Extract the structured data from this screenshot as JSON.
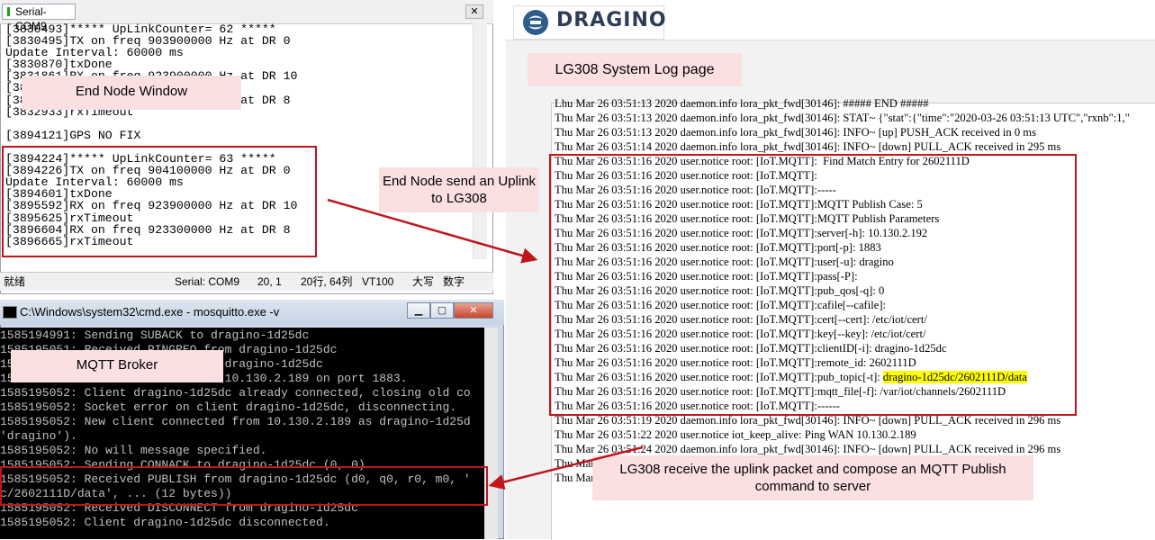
{
  "serial": {
    "tab_title": "Serial-COM9",
    "close_glyph": "✕",
    "lines": [
      "[3830493]***** UpLinkCounter= 62 *****",
      "[3830495]TX on freq 903900000 Hz at DR 0",
      "Update Interval: 60000 ms",
      "[3830870]txDone",
      "[3831861]RX on freq 923900000 Hz at DR 10",
      "[3831896]rxTimeout",
      "[3832904]RX on freq 923300000 Hz at DR 8",
      "[3832933]rxTimeout",
      "",
      "[3894121]GPS NO FIX",
      "",
      "[3894224]***** UpLinkCounter= 63 *****",
      "[3894226]TX on freq 904100000 Hz at DR 0",
      "Update Interval: 60000 ms",
      "[3894601]txDone",
      "[3895592]RX on freq 923900000 Hz at DR 10",
      "[3895625]rxTimeout",
      "[3896604]RX on freq 923300000 Hz at DR 8",
      "[3896665]rxTimeout"
    ],
    "status": {
      "ready": "就绪",
      "port": "Serial: COM9",
      "pos": "20,  1",
      "rowcol": "20行, 64列",
      "vt": "VT100",
      "caps": "大写",
      "num": "数字"
    }
  },
  "annotations": {
    "end_node_window": "End Node Window",
    "end_node_send": "End Node send an Uplink to LG308",
    "mqtt_broker": "MQTT Broker",
    "system_log_page": "LG308 System Log page",
    "lg308_receive": "LG308 receive the uplink packet and compose an MQTT Publish command to server"
  },
  "cmd": {
    "title": "C:\\Windows\\system32\\cmd.exe - mosquitto.exe  -v",
    "lines": [
      "1585194991: Sending SUBACK to dragino-1d25dc",
      "1585195051: Received PINGREQ from dragino-1d25dc",
      "1585195051: Sending PINGRESP to dragino-1d25dc",
      "1585195052: New connection from 10.130.2.189 on port 1883.",
      "1585195052: Client dragino-1d25dc already connected, closing old co",
      "1585195052: Socket error on client dragino-1d25dc, disconnecting.",
      "1585195052: New client connected from 10.130.2.189 as dragino-1d25d",
      "'dragino').",
      "1585195052: No will message specified.",
      "1585195052: Sending CONNACK to dragino-1d25dc (0, 0)",
      "1585195052: Received PUBLISH from dragino-1d25dc (d0, q0, r0, m0, '",
      "c/2602111D/data', ... (12 bytes))",
      "1585195052: Received DISCONNECT from dragino-1d25dc",
      "1585195052: Client dragino-1d25dc disconnected."
    ]
  },
  "lg308": {
    "brand": "DRAGINO",
    "log_lines": [
      "Lhu Mar 26 03:51:13 2020 daemon.info lora_pkt_fwd[30146]: ##### END #####",
      "Thu Mar 26 03:51:13 2020 daemon.info lora_pkt_fwd[30146]: STAT~ {\"stat\":{\"time\":\"2020-03-26 03:51:13 UTC\",\"rxnb\":1,\"",
      "Thu Mar 26 03:51:13 2020 daemon.info lora_pkt_fwd[30146]: INFO~ [up] PUSH_ACK received in 0 ms",
      "Thu Mar 26 03:51:14 2020 daemon.info lora_pkt_fwd[30146]: INFO~ [down] PULL_ACK received in 295 ms",
      "Thu Mar 26 03:51:16 2020 user.notice root: [IoT.MQTT]:  Find Match Entry for 2602111D",
      "Thu Mar 26 03:51:16 2020 user.notice root: [IoT.MQTT]:",
      "Thu Mar 26 03:51:16 2020 user.notice root: [IoT.MQTT]:-----",
      "Thu Mar 26 03:51:16 2020 user.notice root: [IoT.MQTT]:MQTT Publish Case: 5",
      "Thu Mar 26 03:51:16 2020 user.notice root: [IoT.MQTT]:MQTT Publish Parameters",
      "Thu Mar 26 03:51:16 2020 user.notice root: [IoT.MQTT]:server[-h]: 10.130.2.192",
      "Thu Mar 26 03:51:16 2020 user.notice root: [IoT.MQTT]:port[-p]: 1883",
      "Thu Mar 26 03:51:16 2020 user.notice root: [IoT.MQTT]:user[-u]: dragino",
      "Thu Mar 26 03:51:16 2020 user.notice root: [IoT.MQTT]:pass[-P]:",
      "Thu Mar 26 03:51:16 2020 user.notice root: [IoT.MQTT]:pub_qos[-q]: 0",
      "Thu Mar 26 03:51:16 2020 user.notice root: [IoT.MQTT]:cafile[--cafile]:",
      "Thu Mar 26 03:51:16 2020 user.notice root: [IoT.MQTT]:cert[--cert]: /etc/iot/cert/",
      "Thu Mar 26 03:51:16 2020 user.notice root: [IoT.MQTT]:key[--key]: /etc/iot/cert/",
      "Thu Mar 26 03:51:16 2020 user.notice root: [IoT.MQTT]:clientID[-i]: dragino-1d25dc",
      "Thu Mar 26 03:51:16 2020 user.notice root: [IoT.MQTT]:remote_id: 2602111D",
      "Thu Mar 26 03:51:16 2020 user.notice root: [IoT.MQTT]:pub_topic[-t]: ",
      "Thu Mar 26 03:51:16 2020 user.notice root: [IoT.MQTT]:mqtt_file[-f]: /var/iot/channels/2602111D",
      "Thu Mar 26 03:51:16 2020 user.notice root: [IoT.MQTT]:------",
      "Thu Mar 26 03:51:19 2020 daemon.info lora_pkt_fwd[30146]: INFO~ [down] PULL_ACK received in 296 ms",
      "Thu Mar 26 03:51:22 2020 user.notice iot_keep_alive: Ping WAN 10.130.2.189",
      "Thu Mar 26 03:51:24 2020 daemon.info lora_pkt_fwd[30146]: INFO~ [down] PULL_ACK received in 296 ms",
      "Thu Mar",
      "Thu Mar"
    ],
    "pub_topic_value": "dragino-1d25dc/2602111D/data"
  },
  "colors": {
    "annotation_red": "#c0151b",
    "annotation_bg": "#fbe0e2",
    "highlight": "#ffff00"
  }
}
